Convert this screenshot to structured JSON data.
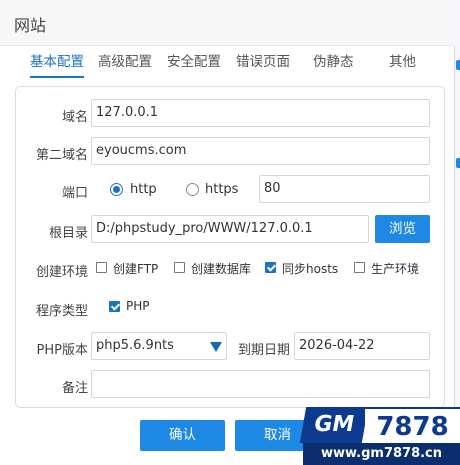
{
  "dialog": {
    "title": "网站",
    "tabs": [
      {
        "label": "基本配置",
        "active": true
      },
      {
        "label": "高级配置",
        "active": false
      },
      {
        "label": "安全配置",
        "active": false
      },
      {
        "label": "错误页面",
        "active": false
      },
      {
        "label": "伪静态",
        "active": false
      },
      {
        "label": "其他",
        "active": false
      }
    ]
  },
  "form": {
    "domain": {
      "label": "域名",
      "value": "127.0.0.1"
    },
    "second_domain": {
      "label": "第二域名",
      "value": "eyoucms.com"
    },
    "port": {
      "label": "端口",
      "options": [
        {
          "label": "http",
          "selected": true
        },
        {
          "label": "https",
          "selected": false
        }
      ],
      "value": "80"
    },
    "root": {
      "label": "根目录",
      "value": "D:/phpstudy_pro/WWW/127.0.0.1",
      "browse_label": "浏览"
    },
    "env": {
      "label": "创建环境",
      "options": [
        {
          "label": "创建FTP",
          "checked": false
        },
        {
          "label": "创建数据库",
          "checked": false
        },
        {
          "label": "同步hosts",
          "checked": true
        },
        {
          "label": "生产环境",
          "checked": false
        }
      ]
    },
    "program_type": {
      "label": "程序类型",
      "options": [
        {
          "label": "PHP",
          "checked": true
        }
      ]
    },
    "php_version": {
      "label": "PHP版本",
      "value": "php5.6.9nts"
    },
    "expiry": {
      "label": "到期日期",
      "value": "2026-04-22"
    },
    "remark": {
      "label": "备注",
      "value": ""
    }
  },
  "footer": {
    "confirm_label": "确认",
    "cancel_label": "取消"
  },
  "watermark": {
    "brand": "GM",
    "number": "7878",
    "url": "www.gm7878.cn"
  },
  "colors": {
    "accent": "#1e88e5",
    "active_tab": "#1a73c8"
  }
}
